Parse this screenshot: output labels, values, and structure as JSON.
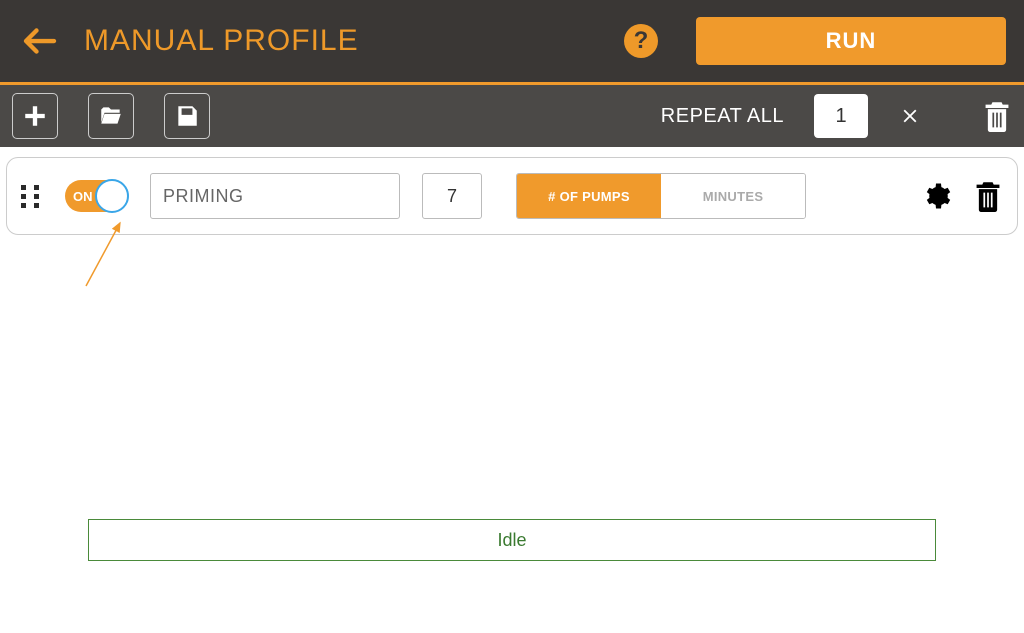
{
  "header": {
    "title": "MANUAL PROFILE",
    "run_label": "RUN"
  },
  "toolbar": {
    "repeat_label": "REPEAT ALL",
    "repeat_value": "1"
  },
  "step": {
    "toggle_label": "ON",
    "name": "PRIMING",
    "value": "7",
    "unit_pumps_label": "# OF PUMPS",
    "unit_minutes_label": "MINUTES"
  },
  "status": {
    "text": "Idle"
  }
}
